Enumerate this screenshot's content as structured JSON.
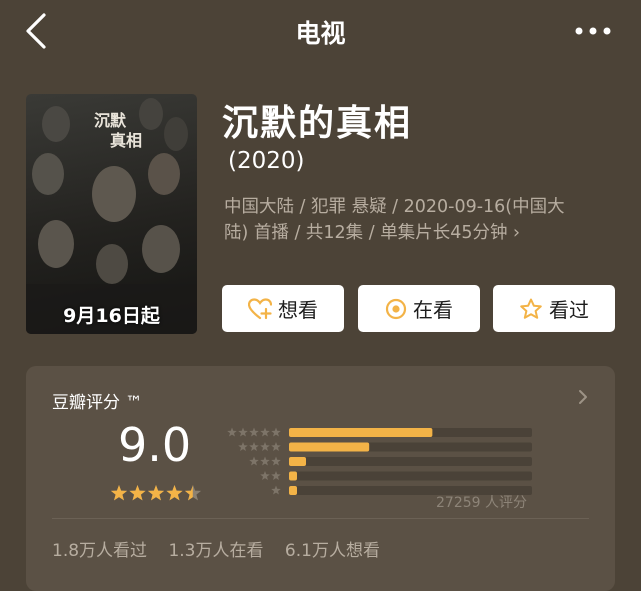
{
  "header": {
    "title": "电视"
  },
  "poster": {
    "date_text": "9月16日起"
  },
  "movie": {
    "title": "沉默的真相",
    "year": "(2020)",
    "meta_line1": "中国大陆 / 犯罪 悬疑 / 2020-09-16(中国大",
    "meta_line2": "陆) 首播 / 共12集 / 单集片长45分钟",
    "meta_chevron": "›"
  },
  "actions": {
    "want_label": "想看",
    "watching_label": "在看",
    "watched_label": "看过"
  },
  "rating": {
    "title": "豆瓣评分 ™",
    "score": "9.0",
    "star_fraction": 0.9,
    "votes_text": "27259 人评分",
    "distribution": [
      {
        "stars": 5,
        "fraction": 0.59
      },
      {
        "stars": 4,
        "fraction": 0.33
      },
      {
        "stars": 3,
        "fraction": 0.07
      },
      {
        "stars": 2,
        "fraction": 0.01
      },
      {
        "stars": 1,
        "fraction": 0.01
      }
    ],
    "bar_color": "#f3b347",
    "track_color": "#4a4238",
    "stats": {
      "watched": "1.8万人看过",
      "watching": "1.3万人在看",
      "want": "6.1万人想看"
    }
  },
  "colors": {
    "background": "#4c4337",
    "card": "#5b5145",
    "accent": "#f3b347"
  }
}
